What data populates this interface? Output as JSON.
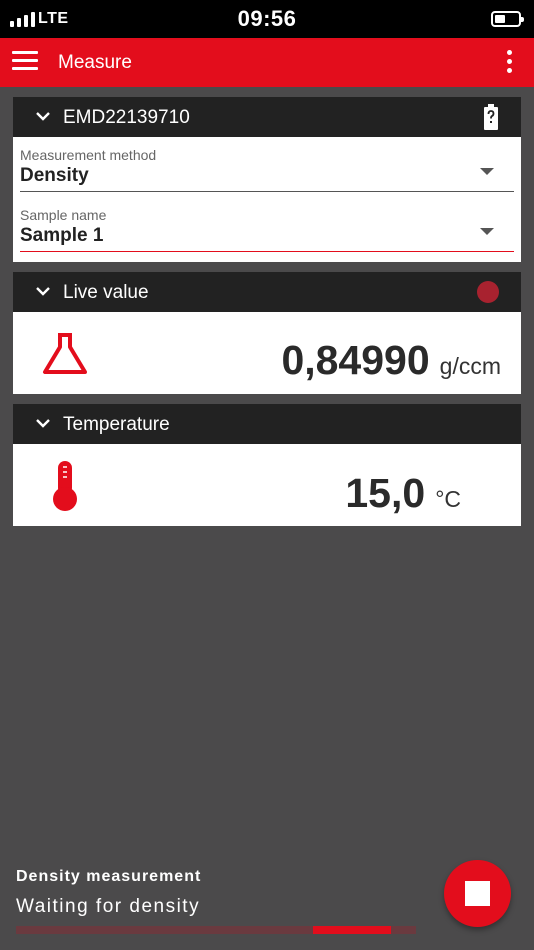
{
  "status_bar": {
    "carrier": "LTE",
    "time": "09:56",
    "battery_level": 0.45
  },
  "app_bar": {
    "title": "Measure",
    "icons": [
      "hamburger-menu-icon",
      "more-vert-icon"
    ]
  },
  "device_card": {
    "title": "EMD22139710",
    "icon": "battery-unknown-icon",
    "method_label": "Measurement method",
    "method_value": "Density",
    "sample_label": "Sample name",
    "sample_value": "Sample 1"
  },
  "live_card": {
    "title": "Live value",
    "value": "0,84990",
    "unit": "g/ccm",
    "icon": "flask-icon",
    "indicator_color": "#a8222f"
  },
  "temp_card": {
    "title": "Temperature",
    "value": "15,0",
    "unit": "°C",
    "icon": "thermometer-icon"
  },
  "bottom": {
    "title": "Density measurement",
    "subtitle": "Waiting for density",
    "fab_icon": "stop-icon"
  },
  "colors": {
    "accent": "#e30d1c",
    "header": "#222222",
    "background": "#4b4a4b"
  }
}
